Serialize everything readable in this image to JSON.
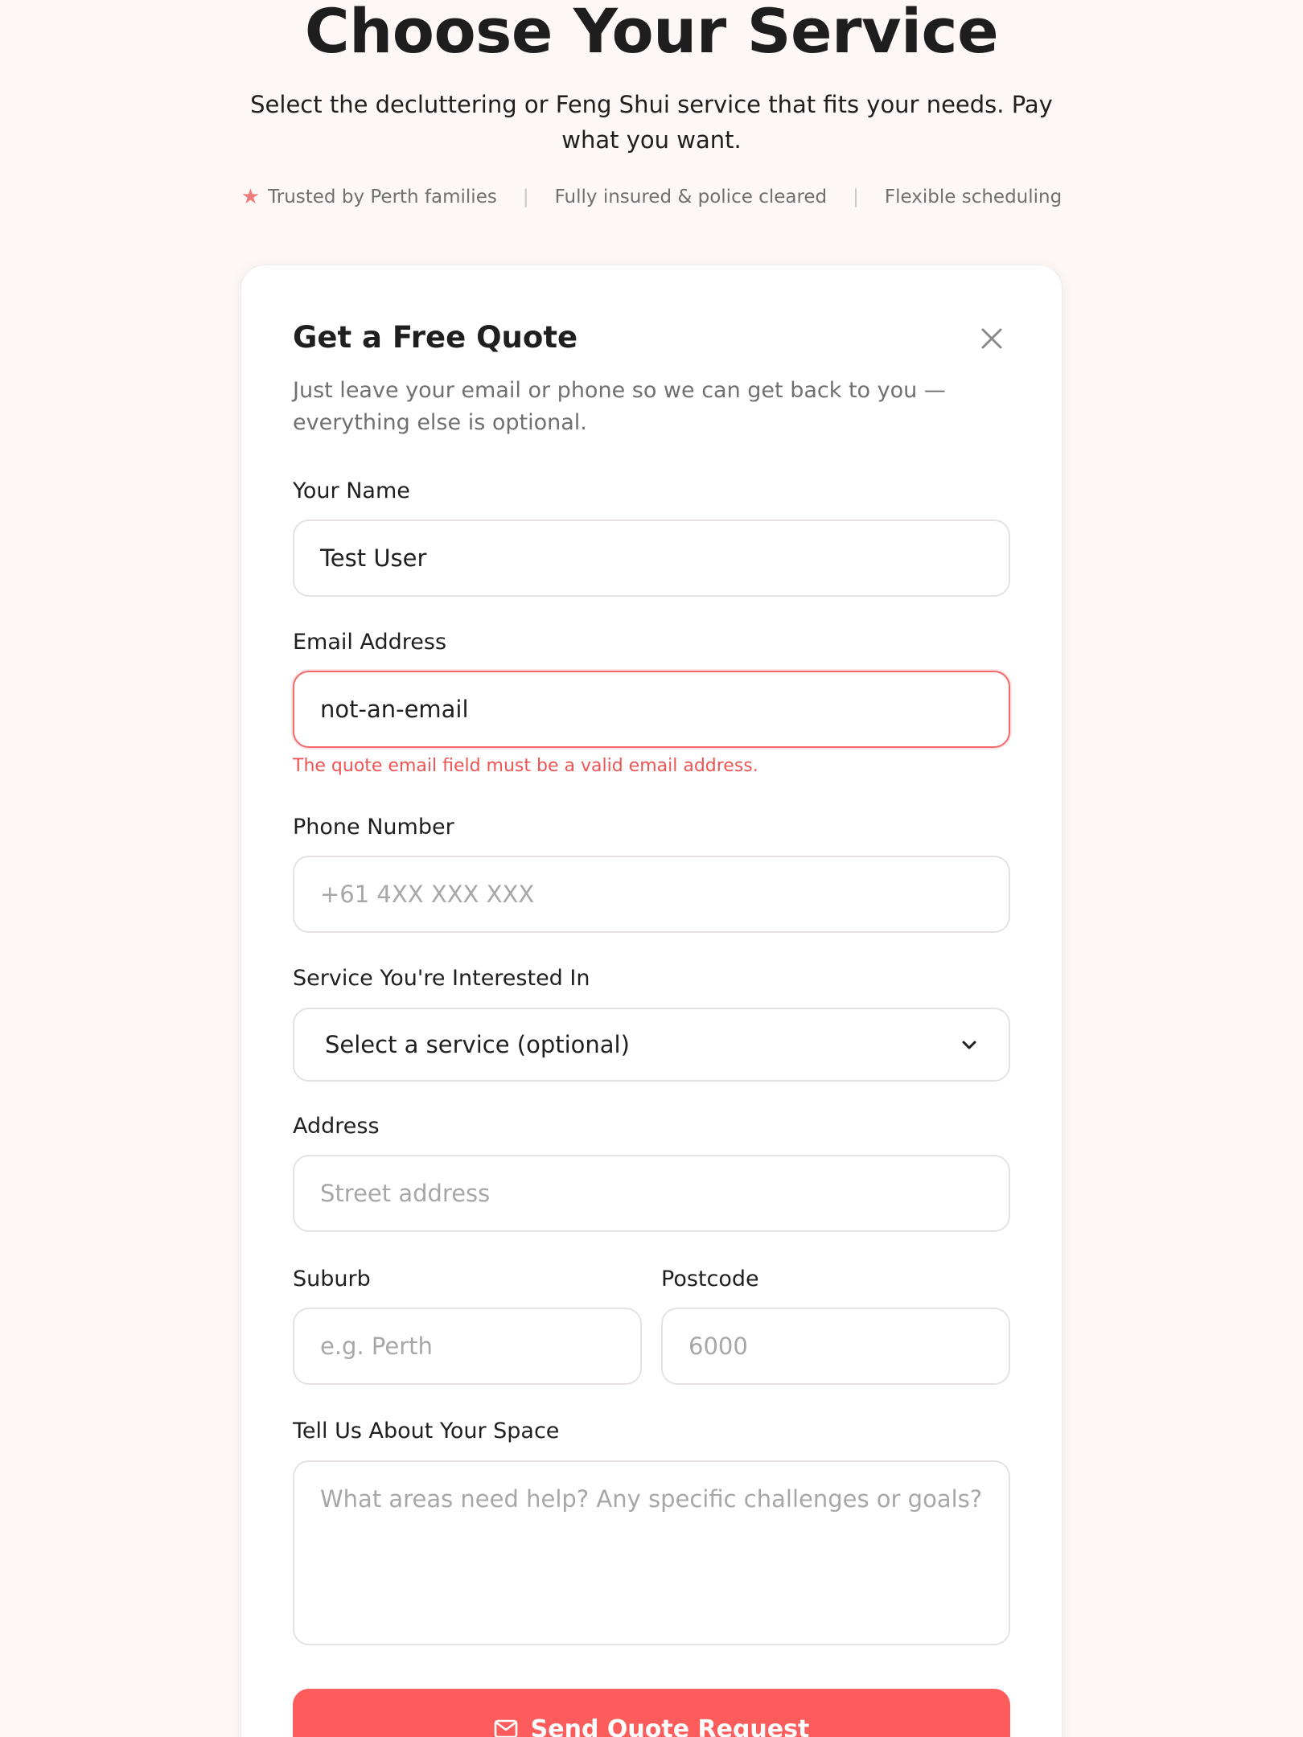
{
  "hero": {
    "title": "Choose Your Service",
    "subtitle": "Select the decluttering or Feng Shui service that fits your needs. Pay what you want.",
    "trust": [
      "Trusted by Perth families",
      "Fully insured & police cleared",
      "Flexible scheduling"
    ],
    "separator": "|"
  },
  "form": {
    "title": "Get a Free Quote",
    "description": "Just leave your email or phone so we can get back to you — everything else is optional.",
    "name": {
      "label": "Your Name",
      "value": "Test User",
      "placeholder": ""
    },
    "email": {
      "label": "Email Address",
      "value": "not-an-email",
      "error": "The quote email field must be a valid email address."
    },
    "phone": {
      "label": "Phone Number",
      "placeholder": "+61 4XX XXX XXX"
    },
    "service": {
      "label": "Service You're Interested In",
      "selected": "Select a service (optional)"
    },
    "address": {
      "label": "Address",
      "placeholder": "Street address"
    },
    "suburb": {
      "label": "Suburb",
      "placeholder": "e.g. Perth"
    },
    "postcode": {
      "label": "Postcode",
      "placeholder": "6000"
    },
    "space": {
      "label": "Tell Us About Your Space",
      "placeholder": "What areas need help? Any specific challenges or goals?"
    },
    "submit_label": "Send Quote Request"
  },
  "colors": {
    "accent": "#fd5c5c",
    "error": "#ef5454",
    "background": "#fdf7f6"
  },
  "icons": {
    "trust": "star-icon",
    "close": "close-icon",
    "select": "chevron-down-icon",
    "submit": "mail-icon"
  }
}
